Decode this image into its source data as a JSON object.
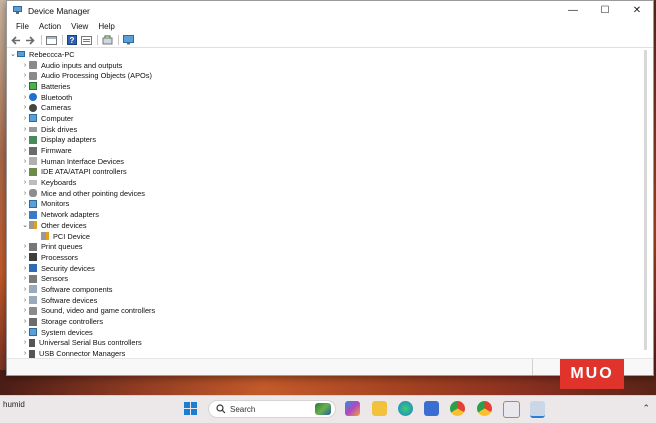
{
  "window": {
    "title": "Device Manager"
  },
  "menu": [
    "File",
    "Action",
    "View",
    "Help"
  ],
  "tree": {
    "root": "Rebeccca-PC",
    "categories": [
      {
        "label": "Audio inputs and outputs",
        "icon": "speaker-icon"
      },
      {
        "label": "Audio Processing Objects (APOs)",
        "icon": "speaker-icon"
      },
      {
        "label": "Batteries",
        "icon": "battery-icon"
      },
      {
        "label": "Bluetooth",
        "icon": "bluetooth-icon"
      },
      {
        "label": "Cameras",
        "icon": "camera-icon"
      },
      {
        "label": "Computer",
        "icon": "monitor-icon"
      },
      {
        "label": "Disk drives",
        "icon": "disk-icon"
      },
      {
        "label": "Display adapters",
        "icon": "display-adapter-icon"
      },
      {
        "label": "Firmware",
        "icon": "chip-icon"
      },
      {
        "label": "Human Interface Devices",
        "icon": "hid-icon"
      },
      {
        "label": "IDE ATA/ATAPI controllers",
        "icon": "controller-icon"
      },
      {
        "label": "Keyboards",
        "icon": "keyboard-icon"
      },
      {
        "label": "Mice and other pointing devices",
        "icon": "mouse-icon"
      },
      {
        "label": "Monitors",
        "icon": "monitor-icon"
      },
      {
        "label": "Network adapters",
        "icon": "network-icon"
      },
      {
        "label": "Other devices",
        "icon": "warning-device-icon",
        "expanded": true,
        "children": [
          {
            "label": "PCI Device",
            "icon": "warning-device-icon"
          }
        ]
      },
      {
        "label": "Print queues",
        "icon": "printer-icon"
      },
      {
        "label": "Processors",
        "icon": "cpu-icon"
      },
      {
        "label": "Security devices",
        "icon": "security-icon"
      },
      {
        "label": "Sensors",
        "icon": "sensor-icon"
      },
      {
        "label": "Software components",
        "icon": "component-icon"
      },
      {
        "label": "Software devices",
        "icon": "component-icon"
      },
      {
        "label": "Sound, video and game controllers",
        "icon": "speaker-icon"
      },
      {
        "label": "Storage controllers",
        "icon": "storage-icon"
      },
      {
        "label": "System devices",
        "icon": "monitor-icon"
      },
      {
        "label": "Universal Serial Bus controllers",
        "icon": "usb-icon"
      },
      {
        "label": "USB Connector Managers",
        "icon": "usb-icon"
      }
    ]
  },
  "watermark": "MUO",
  "taskbar": {
    "weather": "humid",
    "search_label": "Search"
  }
}
